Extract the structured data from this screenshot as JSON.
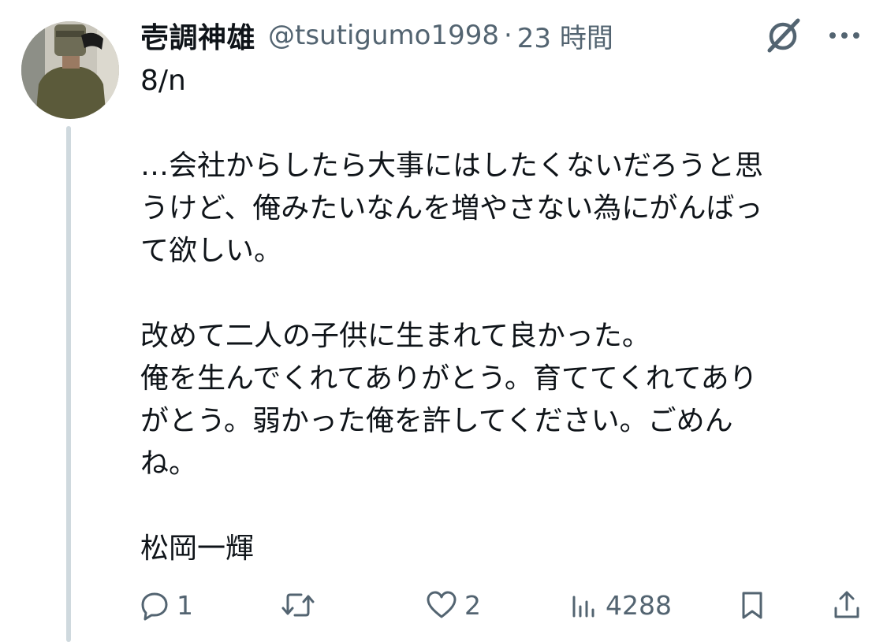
{
  "author": {
    "display_name": "壱調神雄",
    "handle": "@tsutigumo1998",
    "separator": "·",
    "time": "23 時間"
  },
  "tweet": {
    "paragraphs": [
      [
        "8/n"
      ],
      [
        "…会社からしたら大事にはしたくないだろうと思",
        "うけど、俺みたいなんを増やさない為にがんばっ",
        "て欲しい。"
      ],
      [
        "改めて二人の子供に生まれて良かった。",
        "俺を生んでくれてありがとう。育ててくれてあり",
        "がとう。弱かった俺を許してください。ごめん",
        "ね。"
      ],
      [
        "松岡一輝"
      ]
    ]
  },
  "actions": {
    "reply_count": "1",
    "retweet_count": "",
    "like_count": "2",
    "views_count": "4288"
  },
  "icons": {
    "header_right": [
      "grok-icon",
      "more-icon"
    ],
    "action_bar": [
      "reply-icon",
      "retweet-icon",
      "like-icon",
      "views-icon",
      "bookmark-icon",
      "share-icon"
    ]
  },
  "colors": {
    "text": "#0f1419",
    "secondary": "#536471",
    "thread_line": "#cfd9de",
    "background": "#ffffff"
  }
}
